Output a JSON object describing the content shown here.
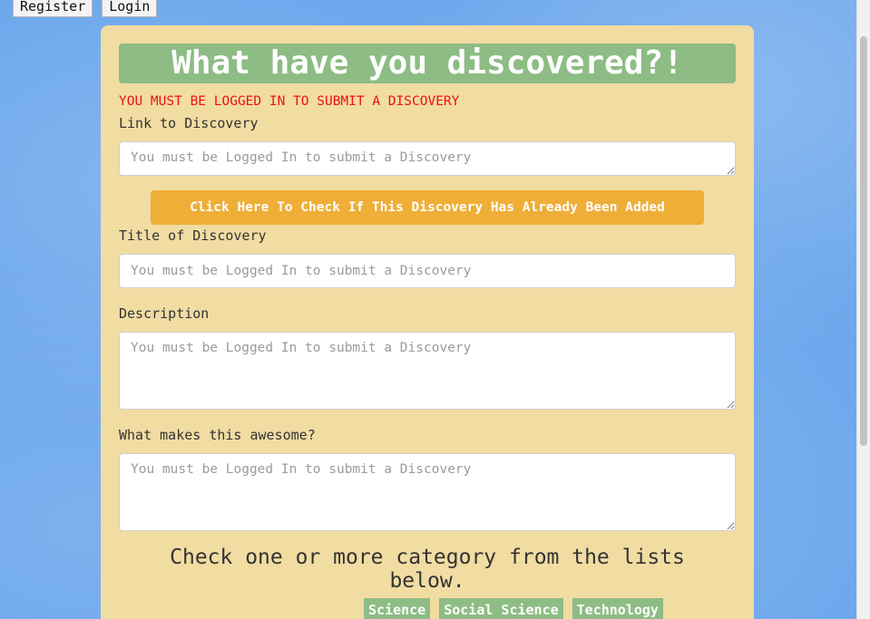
{
  "topnav": {
    "register_label": "Register",
    "login_label": "Login"
  },
  "form": {
    "banner_title": "What have you discovered?!",
    "login_warning": "YOU MUST BE LOGGED IN TO SUBMIT A DISCOVERY",
    "link_label": "Link to Discovery",
    "link_placeholder": "You must be Logged In to submit a Discovery",
    "check_button_label": "Click Here To Check If This Discovery Has Already Been Added",
    "title_label": "Title of Discovery",
    "title_placeholder": "You must be Logged In to submit a Discovery",
    "description_label": "Description",
    "description_placeholder": "You must be Logged In to submit a Discovery",
    "awesome_label": "What makes this awesome?",
    "awesome_placeholder": "You must be Logged In to submit a Discovery",
    "category_heading": "Check one or more category from the lists below.",
    "categories": [
      "Science",
      "Social Science",
      "Technology"
    ]
  },
  "colors": {
    "background": "#6aa6ec",
    "card": "#f1dca2",
    "banner": "#8dbc84",
    "warning": "#ee1111",
    "check_button": "#efae37"
  }
}
